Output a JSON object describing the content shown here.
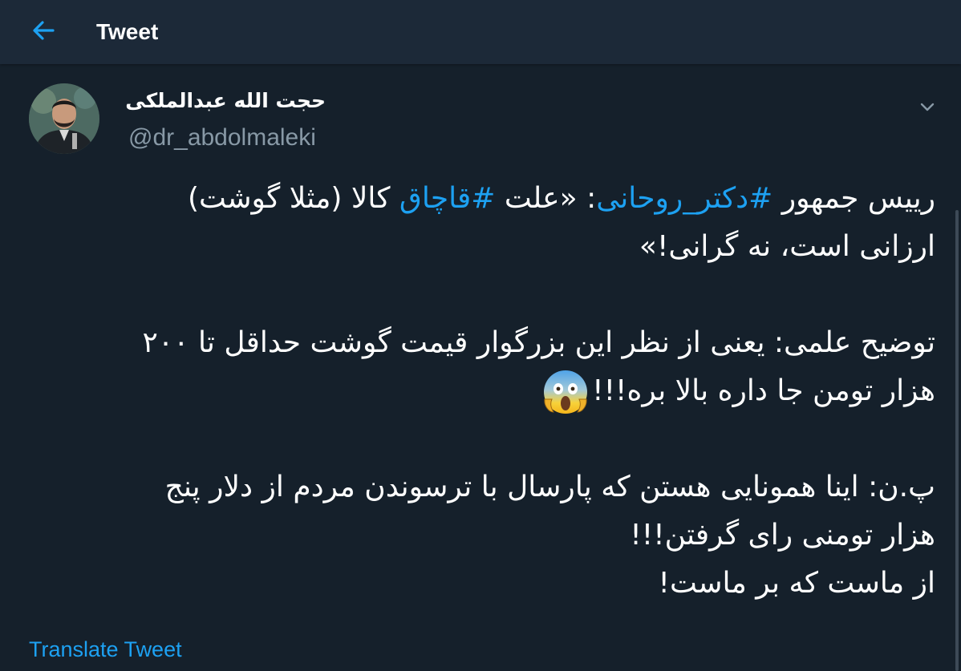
{
  "header": {
    "back_icon": "arrow-left-icon",
    "title": "Tweet"
  },
  "author": {
    "name": "حجت الله عبدالملکی",
    "handle": "@dr_abdolmaleki",
    "avatar_icon": "avatar-photo"
  },
  "menu_icon": "chevron-down-icon",
  "tweet": {
    "p1_l1_a": "رییس جمهور ",
    "p1_h1": "#دکتر_روحانی",
    "p1_l1_b": ": «علت ",
    "p1_h2": "#قاچاق",
    "p1_l1_c": " کالا (مثلا گوشت)",
    "p1_l2": "ارزانی است، نه گرانی!»",
    "p2_l1": "توضیح علمی: یعنی از نظر این بزرگوار قیمت گوشت حداقل تا ۲۰۰",
    "p2_l2": "هزار تومن جا داره بالا بره!!!",
    "emoji_icon": "screaming-face-emoji",
    "p3_l1": "پ.ن: اینا همونایی هستن که پارسال با ترسوندن مردم از دلار پنج",
    "p3_l2": "هزار تومنی رای گرفتن!!!",
    "p3_l3": "از ماست که بر ماست!"
  },
  "translate_label": "Translate Tweet",
  "colors": {
    "background": "#15202b",
    "header": "#1c2938",
    "accent": "#1da1f2",
    "secondary_text": "#8899a6"
  }
}
